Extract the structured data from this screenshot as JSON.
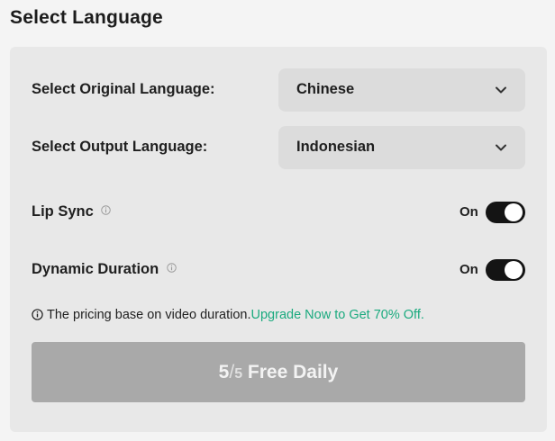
{
  "title": "Select Language",
  "original_language": {
    "label": "Select Original Language:",
    "selected": "Chinese"
  },
  "output_language": {
    "label": "Select Output Language:",
    "selected": "Indonesian"
  },
  "lip_sync": {
    "label": "Lip Sync",
    "state_text": "On",
    "enabled": true
  },
  "dynamic_duration": {
    "label": "Dynamic Duration",
    "state_text": "On",
    "enabled": true
  },
  "pricing_note": {
    "text": "The pricing base on video duration.",
    "link": "Upgrade Now to Get 70% Off."
  },
  "free_button": {
    "used": "5",
    "separator": "/",
    "total": "5",
    "label": " Free Daily"
  },
  "colors": {
    "accent_link": "#1aaa7e",
    "toggle_on": "#141414",
    "button_disabled": "#a9a9a9"
  },
  "icons": [
    "chevron-down-icon",
    "info-icon"
  ]
}
